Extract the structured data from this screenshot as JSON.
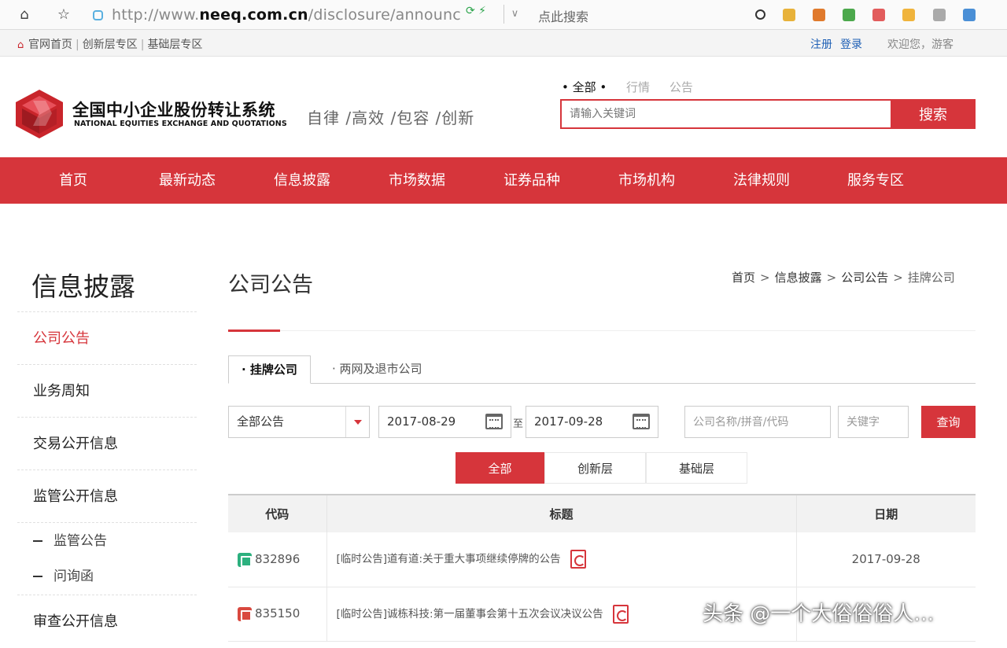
{
  "browser": {
    "url_prefix": "http://www.",
    "url_domain": "neeq.com.cn",
    "url_path": "/disclosure/announc",
    "search_label": "点此搜索"
  },
  "topbar": {
    "links": [
      "官网首页",
      "创新层专区",
      "基础层专区"
    ],
    "register": "注册",
    "login": "登录",
    "welcome": "欢迎您，游客"
  },
  "header": {
    "logo_cn": "全国中小企业股份转让系统",
    "logo_en": "NATIONAL EQUITIES EXCHANGE AND QUOTATIONS",
    "slogan": "自律 /高效 /包容 /创新",
    "search_tabs": [
      "全部",
      "行情",
      "公告"
    ],
    "search_placeholder": "请输入关键词",
    "search_button": "搜索"
  },
  "nav": [
    "首页",
    "最新动态",
    "信息披露",
    "市场数据",
    "证券品种",
    "市场机构",
    "法律规则",
    "服务专区"
  ],
  "sidebar": {
    "title": "信息披露",
    "items": [
      "公司公告",
      "业务周知",
      "交易公开信息",
      "监管公开信息"
    ],
    "sub_items": [
      "监管公告",
      "问询函"
    ],
    "last_item": "审查公开信息"
  },
  "main": {
    "title": "公司公告",
    "breadcrumb": [
      "首页",
      "信息披露",
      "公司公告",
      "挂牌公司"
    ],
    "tabs": [
      "挂牌公司",
      "两网及退市公司"
    ],
    "filter_type": "全部公告",
    "date_from": "2017-08-29",
    "date_to": "2017-09-28",
    "to_label": "至",
    "company_placeholder": "公司名称/拼音/代码",
    "keyword_placeholder": "关键字",
    "query_button": "查询",
    "segments": [
      "全部",
      "创新层",
      "基础层"
    ]
  },
  "table": {
    "headers": [
      "代码",
      "标题",
      "日期"
    ],
    "rows": [
      {
        "code": "832896",
        "title": "[临时公告]道有道:关于重大事项继续停牌的公告",
        "date": "2017-09-28"
      },
      {
        "code": "835150",
        "title": "[临时公告]诚栋科技:第一届董事会第十五次会议决议公告",
        "date": ""
      }
    ]
  },
  "watermark": "头条 @一个大俗俗俗人…",
  "colors": {
    "brand_red": "#d6353b",
    "link_blue": "#1e5fb5"
  }
}
